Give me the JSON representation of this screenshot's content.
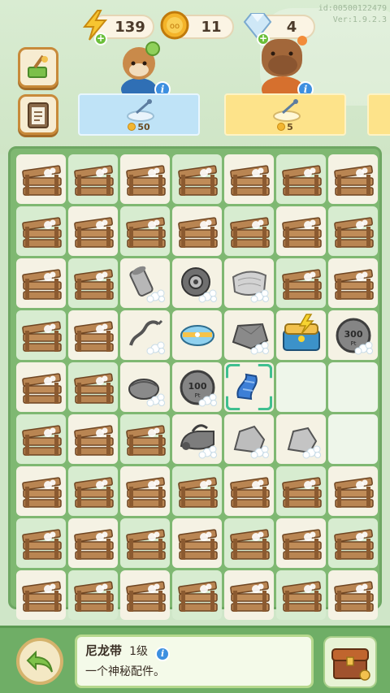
{
  "header": {
    "energy": "139",
    "coins": "11",
    "gems": "4",
    "id_line1": "id:00500122479",
    "id_line2": "Ver:1.9.2.3"
  },
  "stations": [
    {
      "cost": "50",
      "color": "#bfe3f7"
    },
    {
      "cost": "5",
      "color": "#fde38a"
    }
  ],
  "board": {
    "rows": [
      [
        "crate",
        "crate",
        "crate",
        "crate",
        "crate",
        "crate",
        "crate"
      ],
      [
        "crate",
        "crate",
        "crate",
        "crate",
        "crate",
        "crate",
        "crate"
      ],
      [
        "crate",
        "crate",
        "pipe",
        "gear",
        "cloth",
        "crate",
        "crate"
      ],
      [
        "crate",
        "crate",
        "wire",
        "bag",
        "stone",
        "chest_blue",
        "coin300"
      ],
      [
        "crate",
        "crate",
        "pouch",
        "coin100",
        "strap",
        "empty",
        "empty"
      ],
      [
        "crate",
        "crate",
        "crate",
        "iron",
        "rock",
        "rock2",
        "empty"
      ],
      [
        "crate",
        "crate",
        "crate",
        "crate",
        "crate",
        "crate",
        "crate"
      ],
      [
        "crate",
        "crate",
        "crate",
        "crate",
        "crate",
        "crate",
        "crate"
      ],
      [
        "crate",
        "crate",
        "crate",
        "crate",
        "crate",
        "crate",
        "crate"
      ]
    ],
    "selected": [
      4,
      4
    ],
    "coin100_label": "100",
    "coin300_label": "300"
  },
  "info_panel": {
    "name": "尼龙带",
    "level": "1级",
    "description": "一个神秘配件。"
  }
}
